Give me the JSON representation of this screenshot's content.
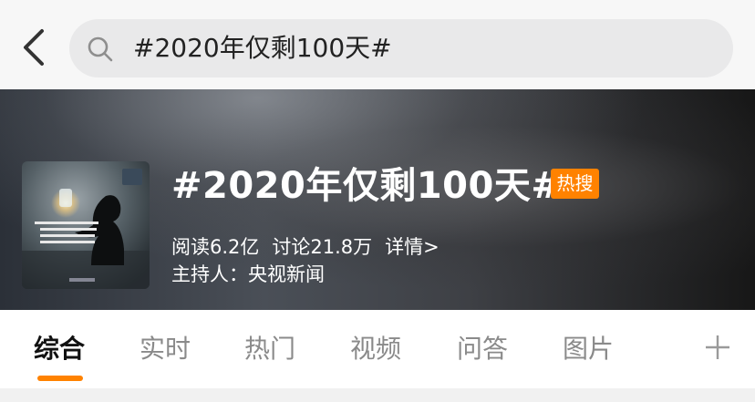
{
  "search": {
    "query": "#2020年仅剩100天#"
  },
  "topic": {
    "title": "#2020年仅剩100天#",
    "badge": "热搜",
    "reads": "阅读6.2亿",
    "discussions": "讨论21.8万",
    "details": "详情>",
    "host": "主持人：央视新闻"
  },
  "tabs": [
    {
      "label": "综合",
      "active": true
    },
    {
      "label": "实时"
    },
    {
      "label": "热门"
    },
    {
      "label": "视频"
    },
    {
      "label": "问答"
    },
    {
      "label": "图片"
    }
  ],
  "colors": {
    "accent": "#ff8200"
  }
}
